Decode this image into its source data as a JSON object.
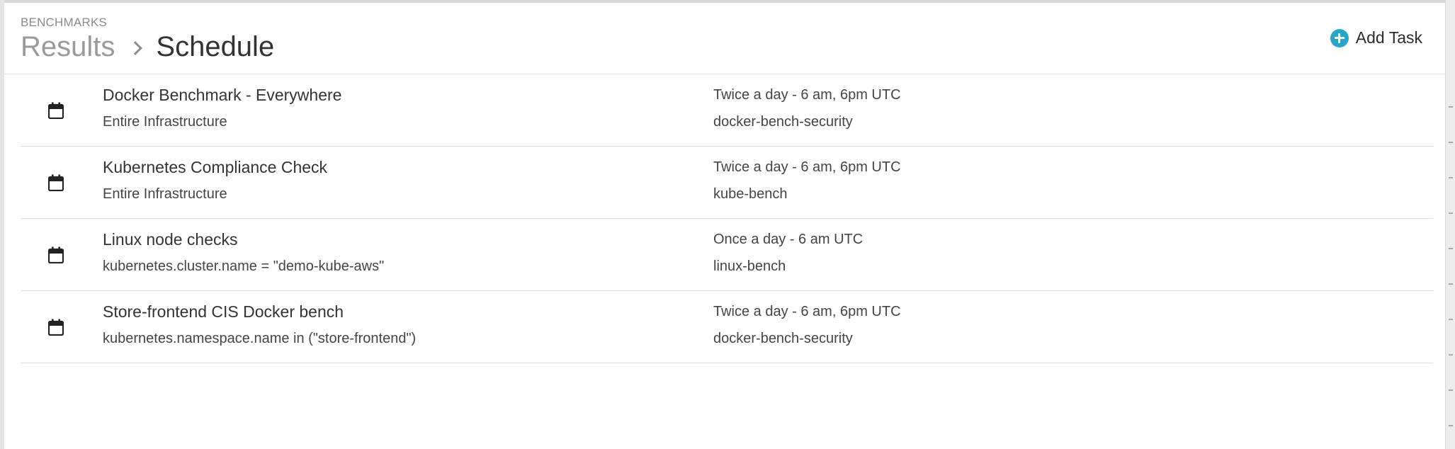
{
  "header": {
    "section_label": "BENCHMARKS",
    "breadcrumb": {
      "parent": "Results",
      "current": "Schedule"
    },
    "add_task_label": "Add Task"
  },
  "tasks": [
    {
      "title": "Docker Benchmark - Everywhere",
      "scope": "Entire Infrastructure",
      "frequency": "Twice a day - 6 am, 6pm UTC",
      "tool": "docker-bench-security"
    },
    {
      "title": "Kubernetes Compliance Check",
      "scope": "Entire Infrastructure",
      "frequency": "Twice a day - 6 am, 6pm UTC",
      "tool": "kube-bench"
    },
    {
      "title": "Linux node checks",
      "scope": "kubernetes.cluster.name = \"demo-kube-aws\"",
      "frequency": "Once a day - 6 am UTC",
      "tool": "linux-bench"
    },
    {
      "title": "Store-frontend CIS Docker bench",
      "scope": "kubernetes.namespace.name in (\"store-frontend\")",
      "frequency": "Twice a day - 6 am, 6pm UTC",
      "tool": "docker-bench-security"
    }
  ],
  "icons": {
    "add": "plus-circle-icon",
    "row": "calendar-icon"
  },
  "colors": {
    "accent": "#2aa5c7",
    "text": "#333333",
    "muted": "#9a9a9a",
    "divider": "#dcdcdc"
  }
}
